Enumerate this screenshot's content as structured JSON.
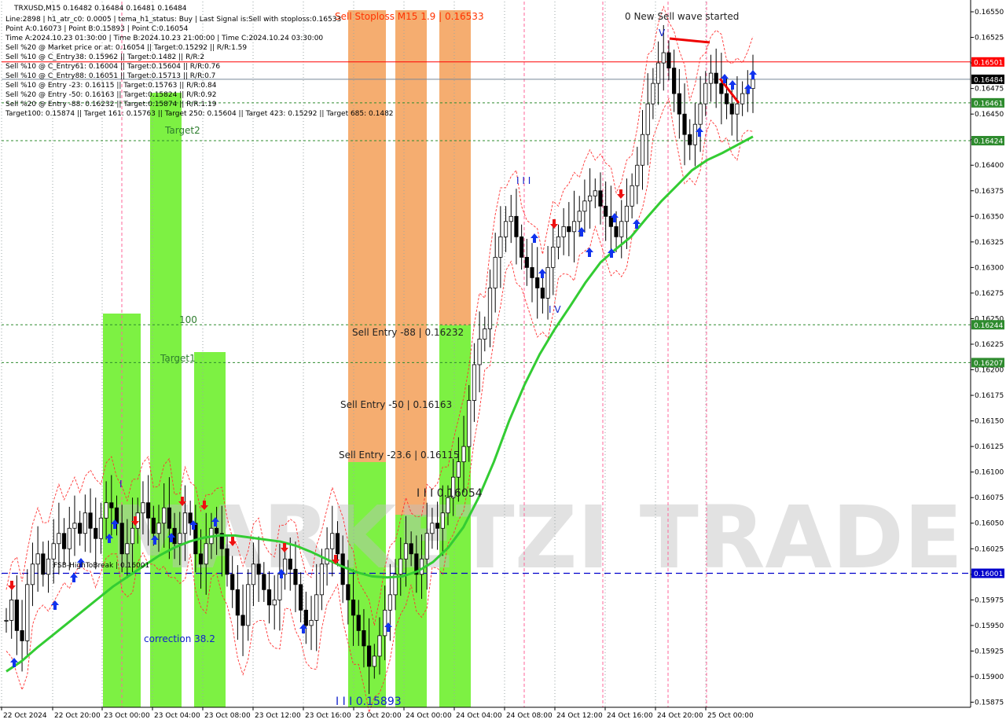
{
  "header": {
    "symbol_line": "TRXUSD,M15  0.16482 0.16484 0.16481 0.16484",
    "info_lines": [
      "Line:2898 | h1_atr_c0: 0.0005 | tema_h1_status: Buy | Last Signal is:Sell with stoploss:0.16533",
      "Point A:0.16073 | Point B:0.15893 | Point C:0.16054",
      "Time A:2024.10.23 01:30:00 | Time B:2024.10.23 21:00:00 | Time C:2024.10.24 03:30:00",
      "Sell %20 @ Market price or at: 0.16054 || Target:0.15292 || R/R:1.59",
      "Sell %10 @ C_Entry38: 0.15962 || Target:0.1482 || R/R:2",
      "Sell %10 @ C_Entry61: 0.16004 || Target:0.15604 || R/R:0.76",
      "Sell %10 @ C_Entry88: 0.16051 || Target:0.15713 || R/R:0.7",
      "Sell %10 @ Entry -23: 0.16115 || Target:0.15763 || R/R:0.84",
      "Sell %20 @ Entry -50: 0.16163 || Target:0.15824 || R/R:0.92",
      "Sell %20 @ Entry -88: 0.16232 || Target:0.15874 || R/R:1.19",
      "Target100: 0.15874 || Target 161: 0.15763 || Target 250: 0.15604 || Target 423: 0.15292 || Target 685: 0.1482"
    ]
  },
  "colors": {
    "bull_zone": "#66ee22",
    "sell_zone": "#f4a460",
    "ma_line": "#33cc33",
    "stop_line": "#ff0000",
    "level_line": "#2e8b2e",
    "dashed_blue": "#0000cc",
    "red_dash": "#ff3333",
    "up_arrow": "#1133ee",
    "down_arrow": "#ee1111"
  },
  "annotations": {
    "stoploss": "Sell Stoploss M15 1.9 | 0.16533",
    "new_wave": "0 New Sell wave started",
    "entry88": "Sell Entry -88 | 0.16232",
    "entry50": "Sell Entry -50 | 0.16163",
    "entry23": "Sell Entry -23.6 | 0.16115",
    "point_c": "I I I 0.16054",
    "point_b": "I I I 0.15893",
    "target1": "Target1",
    "target2": "Target2",
    "hundred": "100",
    "correction": "correction 38.2",
    "fsb": "FSB-HighToBreak | 0.16001",
    "wave_iii": "I I I",
    "wave_iv": "I V",
    "wave_v": "V",
    "wave_i": "I"
  },
  "watermark": "MARKETZI TRADE",
  "chart_data": {
    "type": "candlestick",
    "symbol": "TRXUSD",
    "timeframe": "M15",
    "ylim": [
      0.1587,
      0.1656
    ],
    "y_ticks": [
      "0.16550",
      "0.16525",
      "0.16500",
      "0.16475",
      "0.16450",
      "0.16425",
      "0.16400",
      "0.16375",
      "0.16350",
      "0.16325",
      "0.16300",
      "0.16275",
      "0.16250",
      "0.16225",
      "0.16200",
      "0.16175",
      "0.16150",
      "0.16125",
      "0.16100",
      "0.16075",
      "0.16050",
      "0.16025",
      "0.16000",
      "0.15975",
      "0.15950",
      "0.15925",
      "0.15900",
      "0.15875"
    ],
    "x_ticks": [
      "22 Oct 2024",
      "22 Oct 20:00",
      "23 Oct 00:00",
      "23 Oct 04:00",
      "23 Oct 08:00",
      "23 Oct 12:00",
      "23 Oct 16:00",
      "23 Oct 20:00",
      "24 Oct 00:00",
      "24 Oct 04:00",
      "24 Oct 08:00",
      "24 Oct 12:00",
      "24 Oct 16:00",
      "24 Oct 20:00",
      "25 Oct 00:00"
    ],
    "price_tags": [
      {
        "label": "0.16501",
        "value": 0.16501,
        "color": "#ff0000"
      },
      {
        "label": "0.16484",
        "value": 0.16484,
        "color": "#000000"
      },
      {
        "label": "0.16461",
        "value": 0.16461,
        "color": "#2e8b2e"
      },
      {
        "label": "0.16424",
        "value": 0.16424,
        "color": "#2e8b2e"
      },
      {
        "label": "0.16244",
        "value": 0.16244,
        "color": "#2e8b2e"
      },
      {
        "label": "0.16207",
        "value": 0.16207,
        "color": "#2e8b2e"
      },
      {
        "label": "0.16001",
        "value": 0.16001,
        "color": "#0000cc"
      }
    ],
    "close_series": [
      0.15955,
      0.15975,
      0.15945,
      0.15935,
      0.1599,
      0.1601,
      0.1602,
      0.16,
      0.16015,
      0.1603,
      0.1604,
      0.16025,
      0.16045,
      0.1605,
      0.1604,
      0.1606,
      0.16045,
      0.16035,
      0.16055,
      0.1607,
      0.16065,
      0.1605,
      0.1602,
      0.1603,
      0.16045,
      0.1606,
      0.1607,
      0.16055,
      0.1604,
      0.1605,
      0.16065,
      0.16045,
      0.1603,
      0.1604,
      0.1606,
      0.1605,
      0.1602,
      0.1601,
      0.1603,
      0.16045,
      0.1604,
      0.16025,
      0.16,
      0.15985,
      0.1596,
      0.1595,
      0.1599,
      0.1601,
      0.16,
      0.15985,
      0.1597,
      0.15975,
      0.16,
      0.16015,
      0.16005,
      0.1599,
      0.15965,
      0.1595,
      0.15955,
      0.1598,
      0.1601,
      0.16025,
      0.1604,
      0.1602,
      0.1599,
      0.15975,
      0.1596,
      0.15945,
      0.1593,
      0.1591,
      0.1592,
      0.1594,
      0.15965,
      0.1598,
      0.16,
      0.16015,
      0.1603,
      0.1602,
      0.16,
      0.16015,
      0.1604,
      0.1605,
      0.16045,
      0.1606,
      0.16075,
      0.16095,
      0.1611,
      0.16125,
      0.1617,
      0.16205,
      0.1623,
      0.1624,
      0.1628,
      0.1631,
      0.1633,
      0.16345,
      0.1635,
      0.1633,
      0.1631,
      0.163,
      0.1629,
      0.1628,
      0.1627,
      0.163,
      0.1632,
      0.1633,
      0.1634,
      0.16335,
      0.16345,
      0.16355,
      0.16365,
      0.1637,
      0.16375,
      0.1636,
      0.1635,
      0.1634,
      0.1633,
      0.16345,
      0.1636,
      0.1638,
      0.164,
      0.1643,
      0.1646,
      0.1648,
      0.165,
      0.1651,
      0.16495,
      0.1647,
      0.1645,
      0.1643,
      0.1642,
      0.1644,
      0.1646,
      0.1648,
      0.1649,
      0.1648,
      0.1647,
      0.1646,
      0.1645,
      0.1646,
      0.1647,
      0.16475,
      0.16484
    ],
    "ma_series": [
      0.15905,
      0.15915,
      0.15928,
      0.1594,
      0.15952,
      0.15964,
      0.15976,
      0.15988,
      0.15998,
      0.16008,
      0.16018,
      0.16026,
      0.16032,
      0.16036,
      0.16038,
      0.16038,
      0.16036,
      0.16034,
      0.16032,
      0.16028,
      0.16022,
      0.16015,
      0.16008,
      0.16002,
      0.15998,
      0.15997,
      0.15998,
      0.16003,
      0.16012,
      0.16026,
      0.16046,
      0.16075,
      0.1611,
      0.1615,
      0.16185,
      0.16215,
      0.1624,
      0.16262,
      0.16285,
      0.16305,
      0.16318,
      0.1633,
      0.16348,
      0.16365,
      0.1638,
      0.16395,
      0.16405,
      0.16412,
      0.1642,
      0.16428
    ]
  }
}
